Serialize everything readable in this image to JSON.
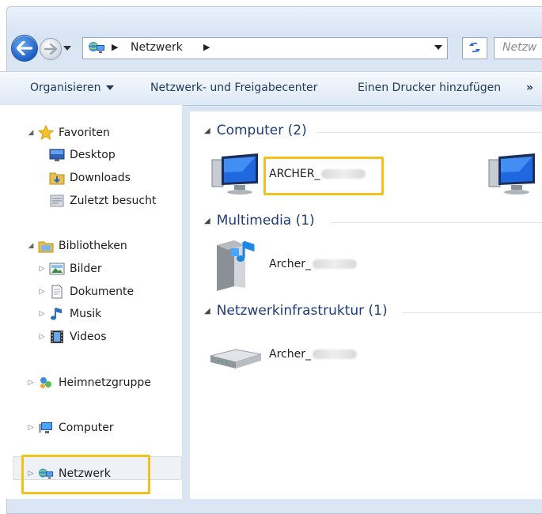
{
  "address_bar": {
    "breadcrumb": "Netzwerk",
    "search_placeholder": "Netzw"
  },
  "toolbar": {
    "organize": "Organisieren",
    "network_center": "Netzwerk- und Freigabecenter",
    "add_printer": "Einen Drucker hinzufügen",
    "more": "»"
  },
  "nav": {
    "favorites": "Favoriten",
    "desktop": "Desktop",
    "downloads": "Downloads",
    "recent": "Zuletzt besucht",
    "libraries": "Bibliotheken",
    "pictures": "Bilder",
    "documents": "Dokumente",
    "music": "Musik",
    "videos": "Videos",
    "homegroup": "Heimnetzgruppe",
    "computer": "Computer",
    "network": "Netzwerk"
  },
  "groups": {
    "computer": "Computer (2)",
    "multimedia": "Multimedia (1)",
    "infrastructure": "Netzwerkinfrastruktur (1)"
  },
  "items": {
    "computer_1": "ARCHER_",
    "multimedia_1": "Archer_",
    "router_1": "Archer_"
  },
  "colors": {
    "highlight": "#f2c21b",
    "group_heading": "#1e3c78"
  }
}
